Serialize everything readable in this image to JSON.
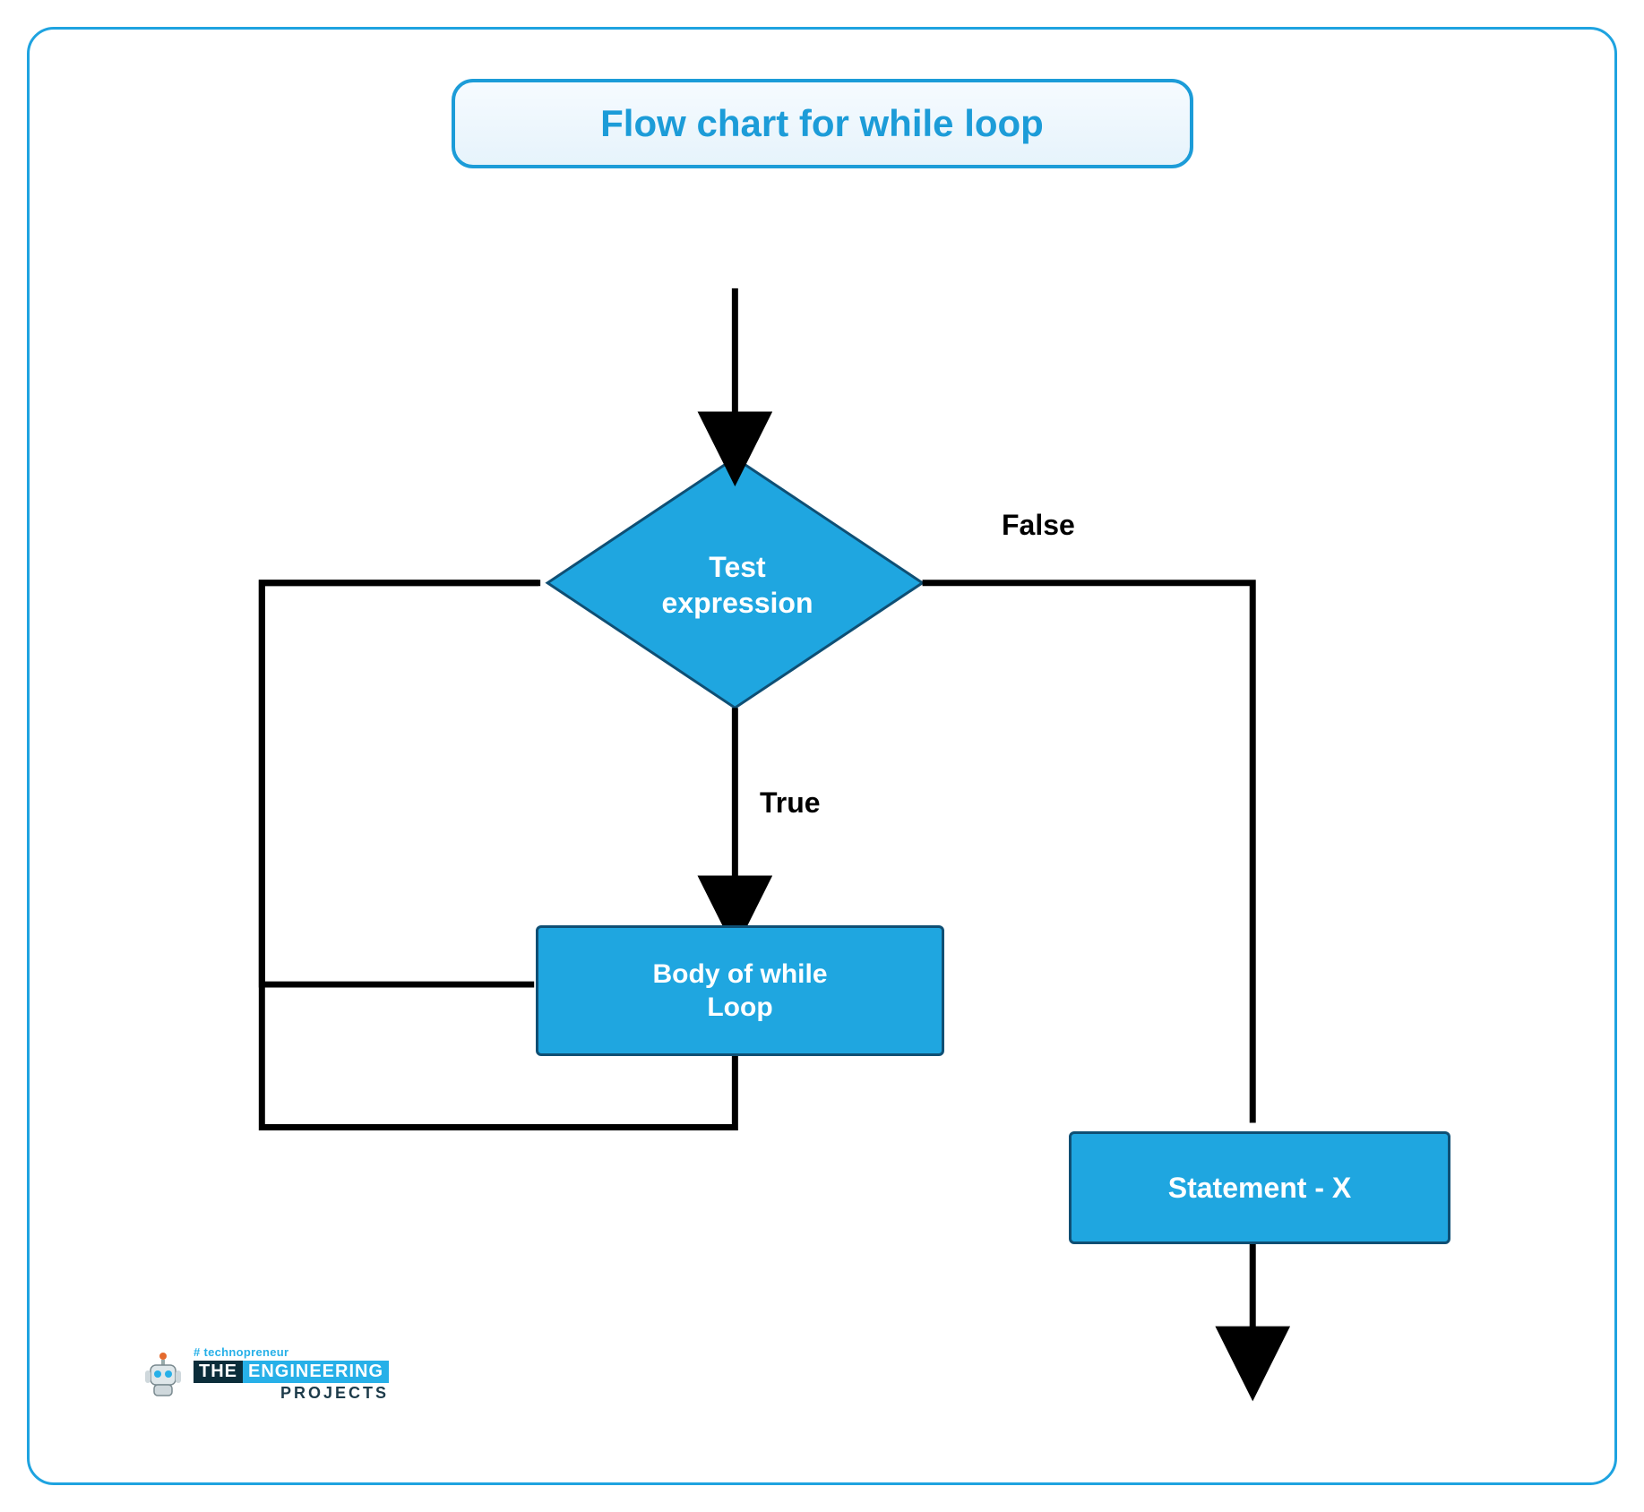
{
  "title": "Flow chart for while loop",
  "nodes": {
    "decision": "Test\nexpression",
    "body": "Body of while\nLoop",
    "statement": "Statement - X"
  },
  "edges": {
    "true_label": "True",
    "false_label": "False"
  },
  "colors": {
    "accent": "#1fa6e0",
    "border": "#1c9cd8",
    "node_border": "#0f4f74",
    "text_white": "#ffffff",
    "text_black": "#000000"
  },
  "watermark": {
    "tag": "# technopreneur",
    "the": "THE",
    "engineering": "ENGINEERING",
    "projects": "PROJECTS"
  }
}
